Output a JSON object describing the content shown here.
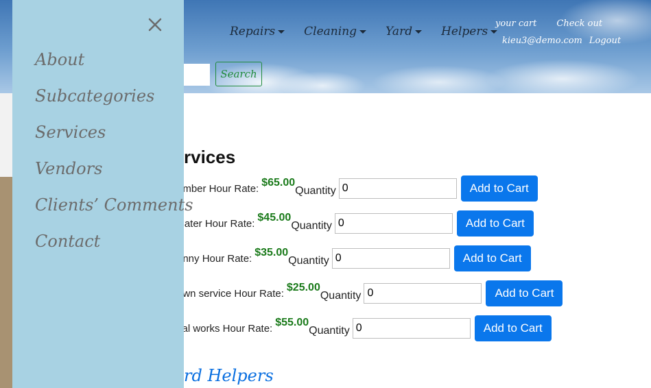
{
  "header": {
    "nav": [
      {
        "label": "Repairs"
      },
      {
        "label": "Cleaning"
      },
      {
        "label": "Yard"
      },
      {
        "label": "Helpers"
      }
    ],
    "cart_label": "your cart",
    "checkout_label": "Check out",
    "user_email": "kieu3@demo.com",
    "logout_label": "Logout",
    "search_button": "Search"
  },
  "sidebar": {
    "close_icon": "close-icon",
    "items": [
      {
        "label": "About"
      },
      {
        "label": "Subcategories"
      },
      {
        "label": "Services"
      },
      {
        "label": "Vendors"
      },
      {
        "label": "Clients’ Comments"
      },
      {
        "label": "Contact"
      }
    ]
  },
  "main": {
    "title": "rvices",
    "quantity_label": "Quantity",
    "add_label": "Add to Cart",
    "services": [
      {
        "name": "umber Hour Rate:",
        "rate": "$65.00",
        "quantity": "0"
      },
      {
        "name": "Cater Hour Rate:",
        "rate": "$45.00",
        "quantity": "0"
      },
      {
        "name": "anny Hour Rate:",
        "rate": "$35.00",
        "quantity": "0"
      },
      {
        "name": "awn service Hour Rate:",
        "rate": "$25.00",
        "quantity": "0"
      },
      {
        "name": "cal works Hour Rate:",
        "rate": "$55.00",
        "quantity": "0"
      }
    ],
    "bottom_links": "rd  Helpers"
  },
  "colors": {
    "sidebar_bg": "#a8d2e3",
    "rate_green": "#1a7a1a",
    "button_blue": "#0a77ec",
    "search_green": "#1f8a3a"
  }
}
